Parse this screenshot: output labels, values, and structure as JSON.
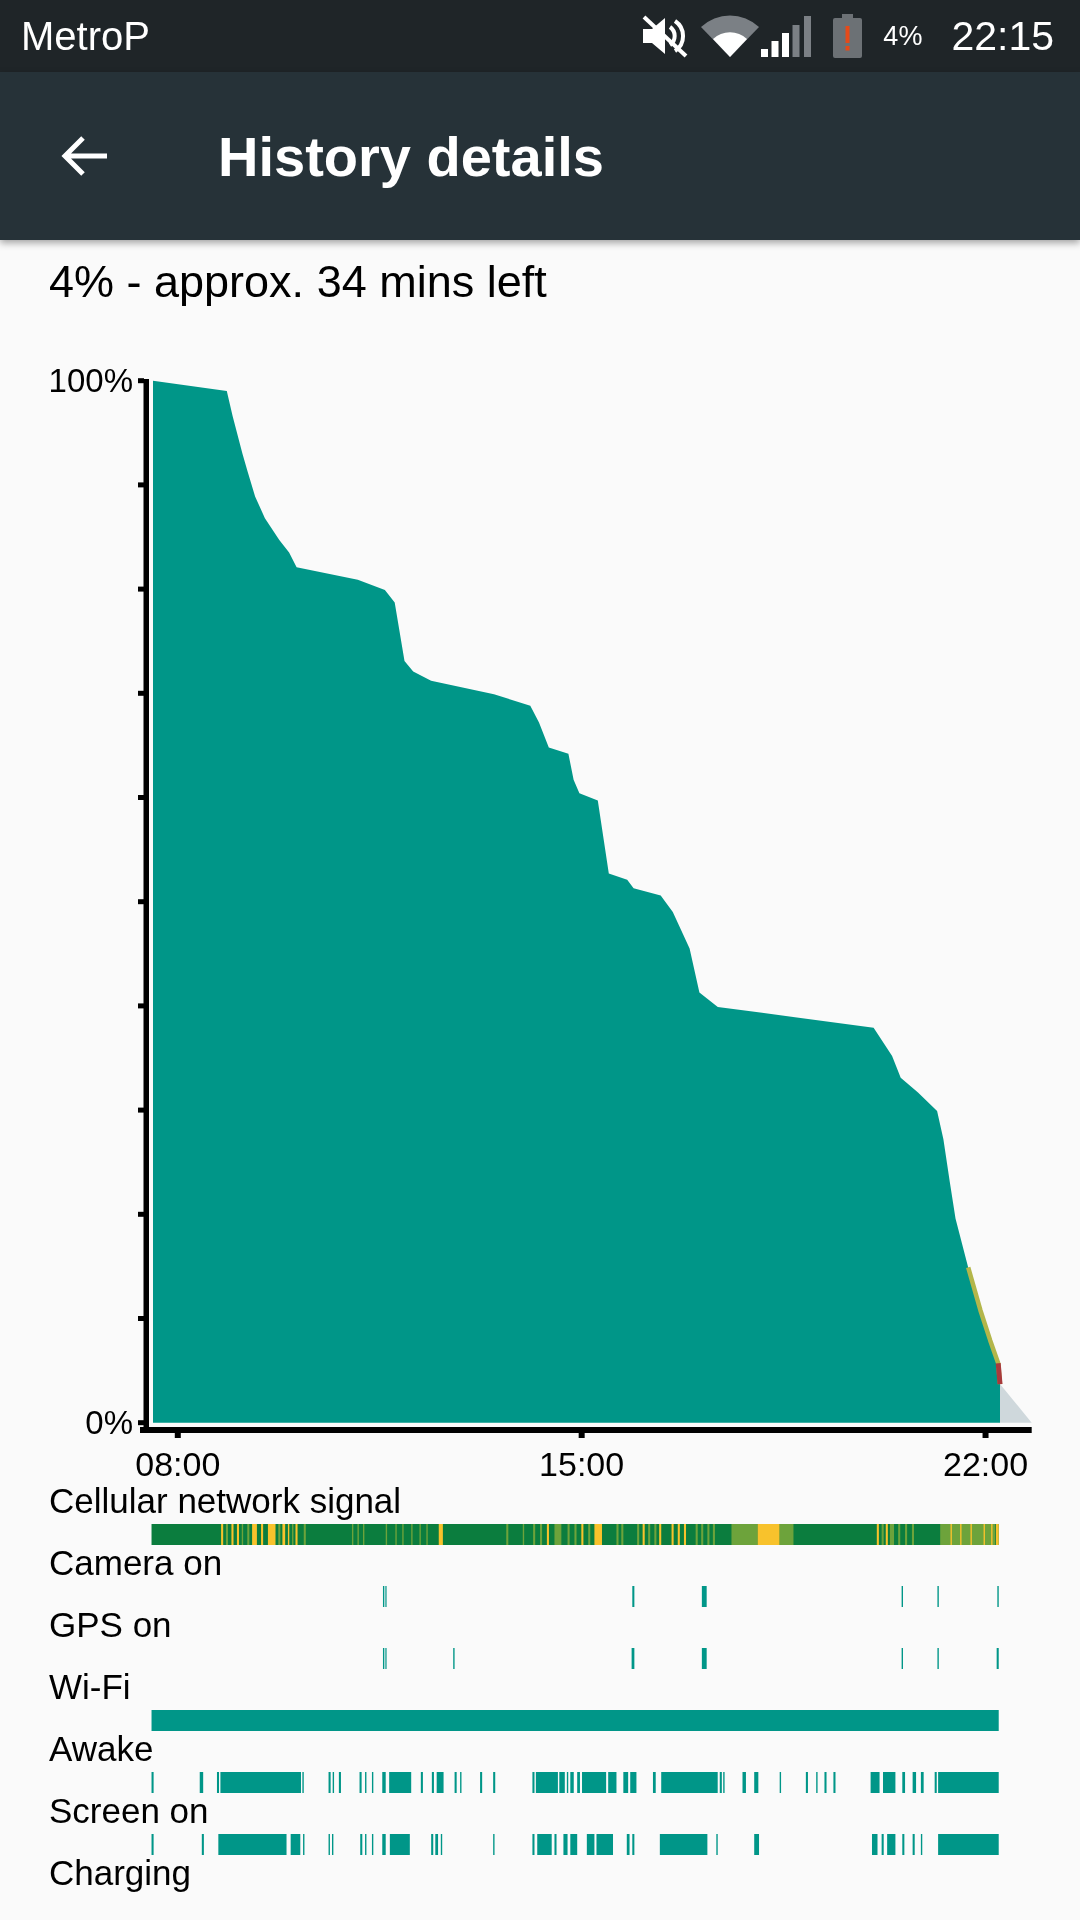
{
  "status_bar": {
    "carrier": "MetroP",
    "battery": "4%",
    "time": "22:15"
  },
  "app_bar": {
    "title": "History details"
  },
  "summary": "4% - approx. 34 mins left",
  "chart": {
    "chart_data": {
      "type": "area",
      "x": [
        7.57,
        8.85,
        8.95,
        9.12,
        9.21,
        9.34,
        9.51,
        9.76,
        9.93,
        10.06,
        11.12,
        11.59,
        11.76,
        11.93,
        12.08,
        12.39,
        13.48,
        14.11,
        14.26,
        14.43,
        14.77,
        14.86,
        14.96,
        15.28,
        15.47,
        15.79,
        15.9,
        16.37,
        16.58,
        16.87,
        17.04,
        17.36,
        20.06,
        20.25,
        20.38,
        20.53,
        20.83,
        21.16,
        21.27,
        21.38,
        21.48,
        21.7,
        21.91,
        22.08,
        22.22,
        22.25
      ],
      "series": [
        {
          "color": "#009688",
          "values": [
            100,
            99,
            96.6,
            93,
            91.3,
            88.9,
            86.8,
            84.7,
            83.5,
            82.1,
            80.9,
            79.9,
            78.7,
            73.1,
            72.1,
            71.2,
            69.9,
            68.8,
            67.2,
            64.8,
            64.2,
            61.7,
            60.4,
            59.7,
            52.7,
            52.1,
            51.3,
            50.6,
            49,
            45.5,
            41.3,
            39.9,
            37.9,
            36.3,
            35.2,
            33.1,
            31.7,
            29.9,
            27.2,
            23.1,
            19.6,
            14.9,
            10.8,
            7.9,
            5.7,
            3.7
          ]
        }
      ],
      "xlim": [
        7.345,
        22.8
      ],
      "ylim": [
        0,
        100
      ],
      "xticks": [
        {
          "value": 8,
          "label": "08:00"
        },
        {
          "value": 15,
          "label": "15:00"
        },
        {
          "value": 22,
          "label": "22:00"
        }
      ],
      "yticks": [
        {
          "value": 0,
          "label": "0%"
        },
        {
          "value": 100,
          "label": "100%"
        }
      ]
    }
  },
  "activity_rows": [
    {
      "label": "Cellular network signal"
    },
    {
      "label": "Camera on"
    },
    {
      "label": "GPS on"
    },
    {
      "label": "Wi-Fi"
    },
    {
      "label": "Awake"
    },
    {
      "label": "Screen on"
    },
    {
      "label": "Charging"
    }
  ]
}
